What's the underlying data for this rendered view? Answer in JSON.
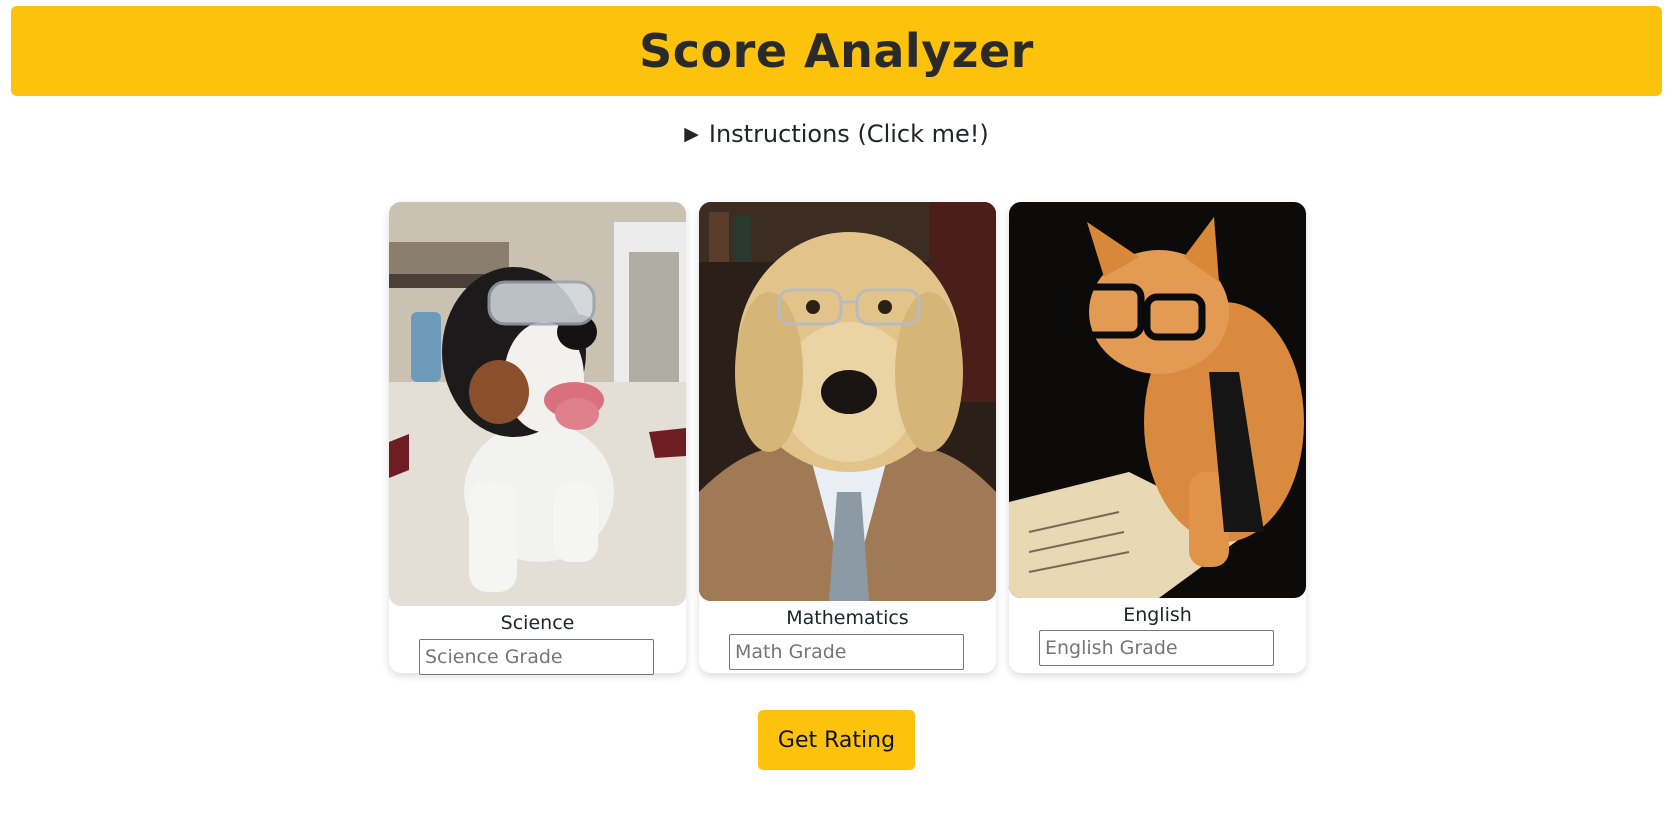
{
  "header": {
    "title": "Score Analyzer"
  },
  "instructions": {
    "label": "Instructions (Click me!)",
    "icon": "triangle-right-icon"
  },
  "subjects": [
    {
      "label": "Science",
      "placeholder": "Science Grade",
      "value": ""
    },
    {
      "label": "Mathematics",
      "placeholder": "Math Grade",
      "value": ""
    },
    {
      "label": "English",
      "placeholder": "English Grade",
      "value": ""
    }
  ],
  "actions": {
    "rating_label": "Get Rating"
  },
  "colors": {
    "accent": "#fdc20c",
    "text": "#212529"
  }
}
